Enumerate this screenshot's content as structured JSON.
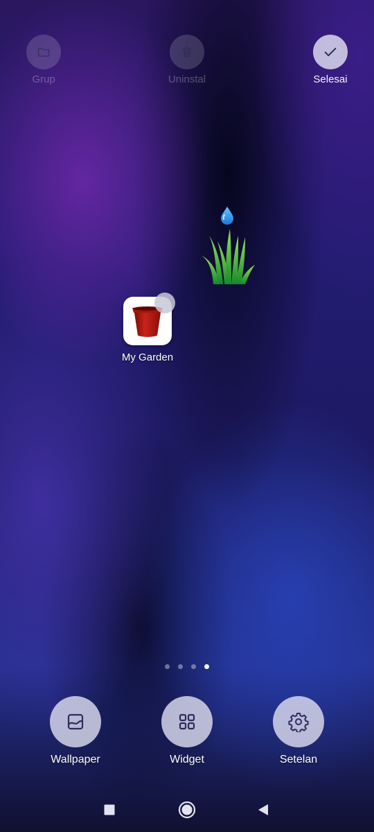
{
  "top_actions": {
    "group": {
      "label": "Grup",
      "icon": "folder-icon",
      "enabled": false
    },
    "uninstall": {
      "label": "Uninstal",
      "icon": "trash-icon",
      "enabled": false
    },
    "done": {
      "label": "Selesai",
      "icon": "checkmark-icon",
      "enabled": true
    }
  },
  "widget": {
    "icon": "grass-water-drop-icon"
  },
  "app": {
    "label": "My Garden",
    "icon": "red-pot-icon",
    "selected": true
  },
  "page_indicator": {
    "count": 4,
    "active_index": 3
  },
  "bottom_tools": {
    "wallpaper": {
      "label": "Wallpaper",
      "icon": "wallpaper-icon"
    },
    "widget": {
      "label": "Widget",
      "icon": "widgets-grid-icon"
    },
    "settings": {
      "label": "Setelan",
      "icon": "gear-icon"
    }
  },
  "navigation": {
    "recents": "square-icon",
    "home": "circle-icon",
    "back": "triangle-back-icon"
  },
  "colors": {
    "icon_dark": "#2b2d5c",
    "pot_red": "#b01a10",
    "grass_green": "#2fae2f",
    "drop_blue": "#2196f3"
  }
}
